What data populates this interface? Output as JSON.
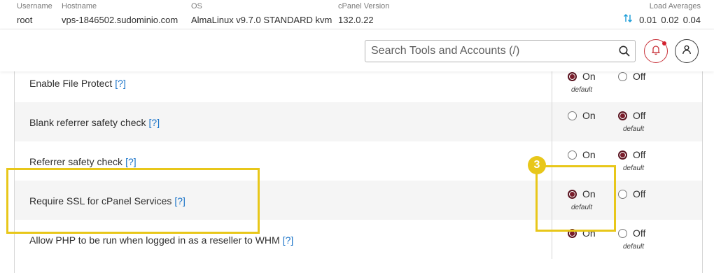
{
  "server_info": {
    "username_label": "Username",
    "username": "root",
    "hostname_label": "Hostname",
    "hostname": "vps-1846502.sudominio.com",
    "os_label": "OS",
    "os": "AlmaLinux v9.7.0 STANDARD kvm",
    "cpanel_label": "cPanel Version",
    "cpanel_version": "132.0.22",
    "load_label": "Load Averages",
    "load_1": "0.01",
    "load_5": "0.02",
    "load_15": "0.04",
    "load_icon": "sort-arrows-icon"
  },
  "header": {
    "search_placeholder": "Search Tools and Accounts (/)",
    "search_icon": "search-icon",
    "notification_icon": "bell-icon",
    "user_icon": "user-icon"
  },
  "settings": {
    "rows": [
      {
        "label": "Enable File Protect",
        "help": "[?]",
        "on_label": "On",
        "off_label": "Off",
        "selected": "On",
        "default_note": "default"
      },
      {
        "label": "Blank referrer safety check",
        "help": "[?]",
        "on_label": "On",
        "off_label": "Off",
        "selected": "Off",
        "default_note": "default"
      },
      {
        "label": "Referrer safety check",
        "help": "[?]",
        "on_label": "On",
        "off_label": "Off",
        "selected": "Off",
        "default_note": "default"
      },
      {
        "label": "Require SSL for cPanel Services",
        "help": "[?]",
        "on_label": "On",
        "off_label": "Off",
        "selected": "On",
        "default_note": "default"
      },
      {
        "label": "Allow PHP to be run when logged in as a reseller to WHM",
        "help": "[?]",
        "on_label": "On",
        "off_label": "Off",
        "selected": "On",
        "default_note": "default"
      }
    ]
  },
  "annotation": {
    "step_number": "3",
    "highlight_color": "#e8c71a"
  },
  "colors": {
    "radio_checked": "#7a1d2b",
    "help_link": "#1a73c8",
    "load_icon": "#179bd7",
    "bell_border": "#c8323a"
  }
}
